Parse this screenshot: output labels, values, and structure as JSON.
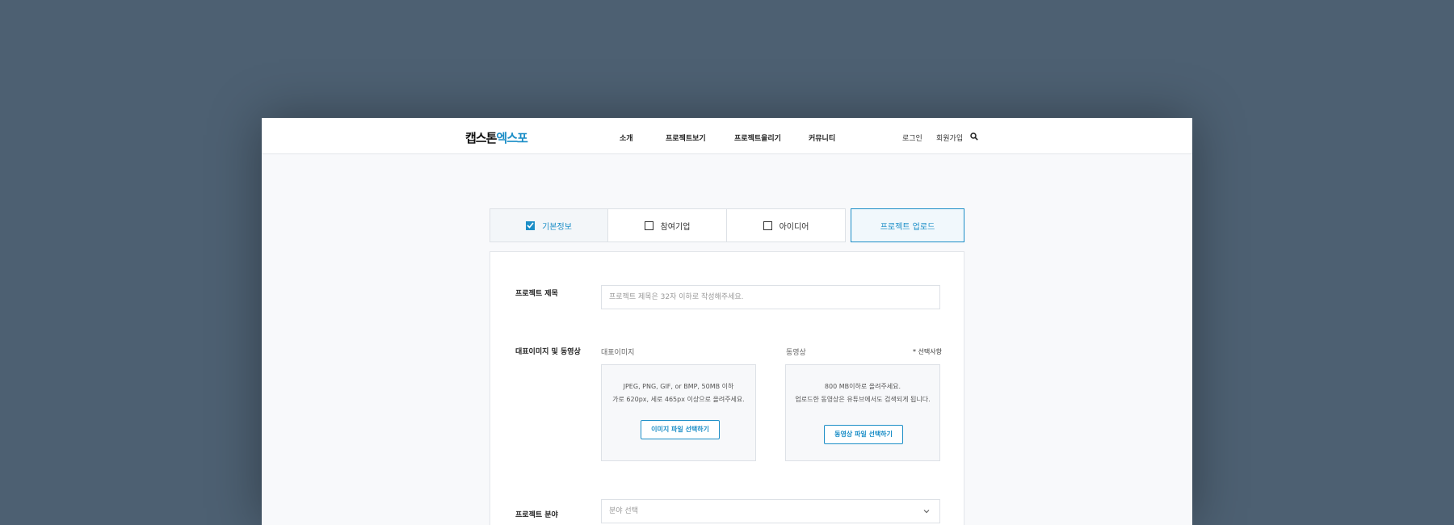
{
  "header": {
    "logo_part1": "캡스톤",
    "logo_part2": "엑스포",
    "nav": [
      "소개",
      "프로젝트보기",
      "프로젝트올리기",
      "커뮤니티"
    ],
    "login": "로그인",
    "signup": "회원가입",
    "search_icon": "search-icon"
  },
  "tabs": [
    {
      "label": "기본정보",
      "checked": true
    },
    {
      "label": "참여기업",
      "checked": false
    },
    {
      "label": "아이디어",
      "checked": false
    }
  ],
  "upload_tab": "프로젝트 업로드",
  "form": {
    "title_label": "프로젝트 제목",
    "title_placeholder": "프로젝트 제목은 32자 이하로 작성해주세요.",
    "media_label": "대표이미지 및 동영상",
    "image_label": "대표이미지",
    "video_label": "동영상",
    "optional_note": "* 선택사항",
    "image_line1": "JPEG, PNG, GIF, or BMP, 50MB 이하",
    "image_line2": "가로 620px, 세로 465px 이상으로 올려주세요.",
    "image_button": "이미지 파일 선택하기",
    "video_line1": "800 MB이하로 올려주세요.",
    "video_line2": "업로드한 동영상은 유튜브에서도 검색되게 됩니다.",
    "video_button": "동영상 파일 선택하기",
    "field_label": "프로젝트 분야",
    "field_placeholder": "분야 선택"
  },
  "colors": {
    "accent": "#1c8ec7",
    "background": "#4d6072"
  }
}
